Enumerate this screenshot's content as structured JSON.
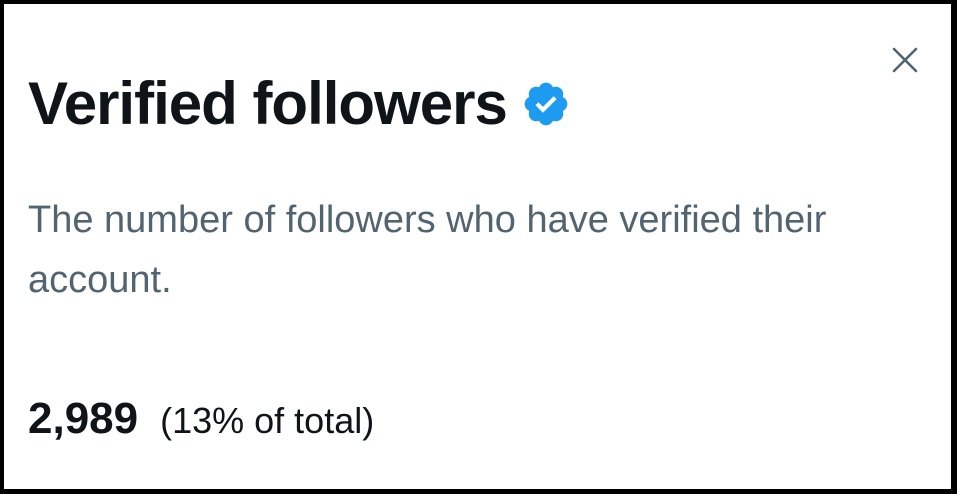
{
  "dialog": {
    "title": "Verified followers",
    "description": "The number of followers who have verified their account.",
    "stat_value": "2,989",
    "stat_share": "(13% of total)",
    "icons": {
      "close": "close-icon",
      "verified": "verified-badge-icon"
    },
    "colors": {
      "title": "#0f1419",
      "description": "#536471",
      "badge": "#1d9bf0",
      "close": "#536471"
    }
  }
}
